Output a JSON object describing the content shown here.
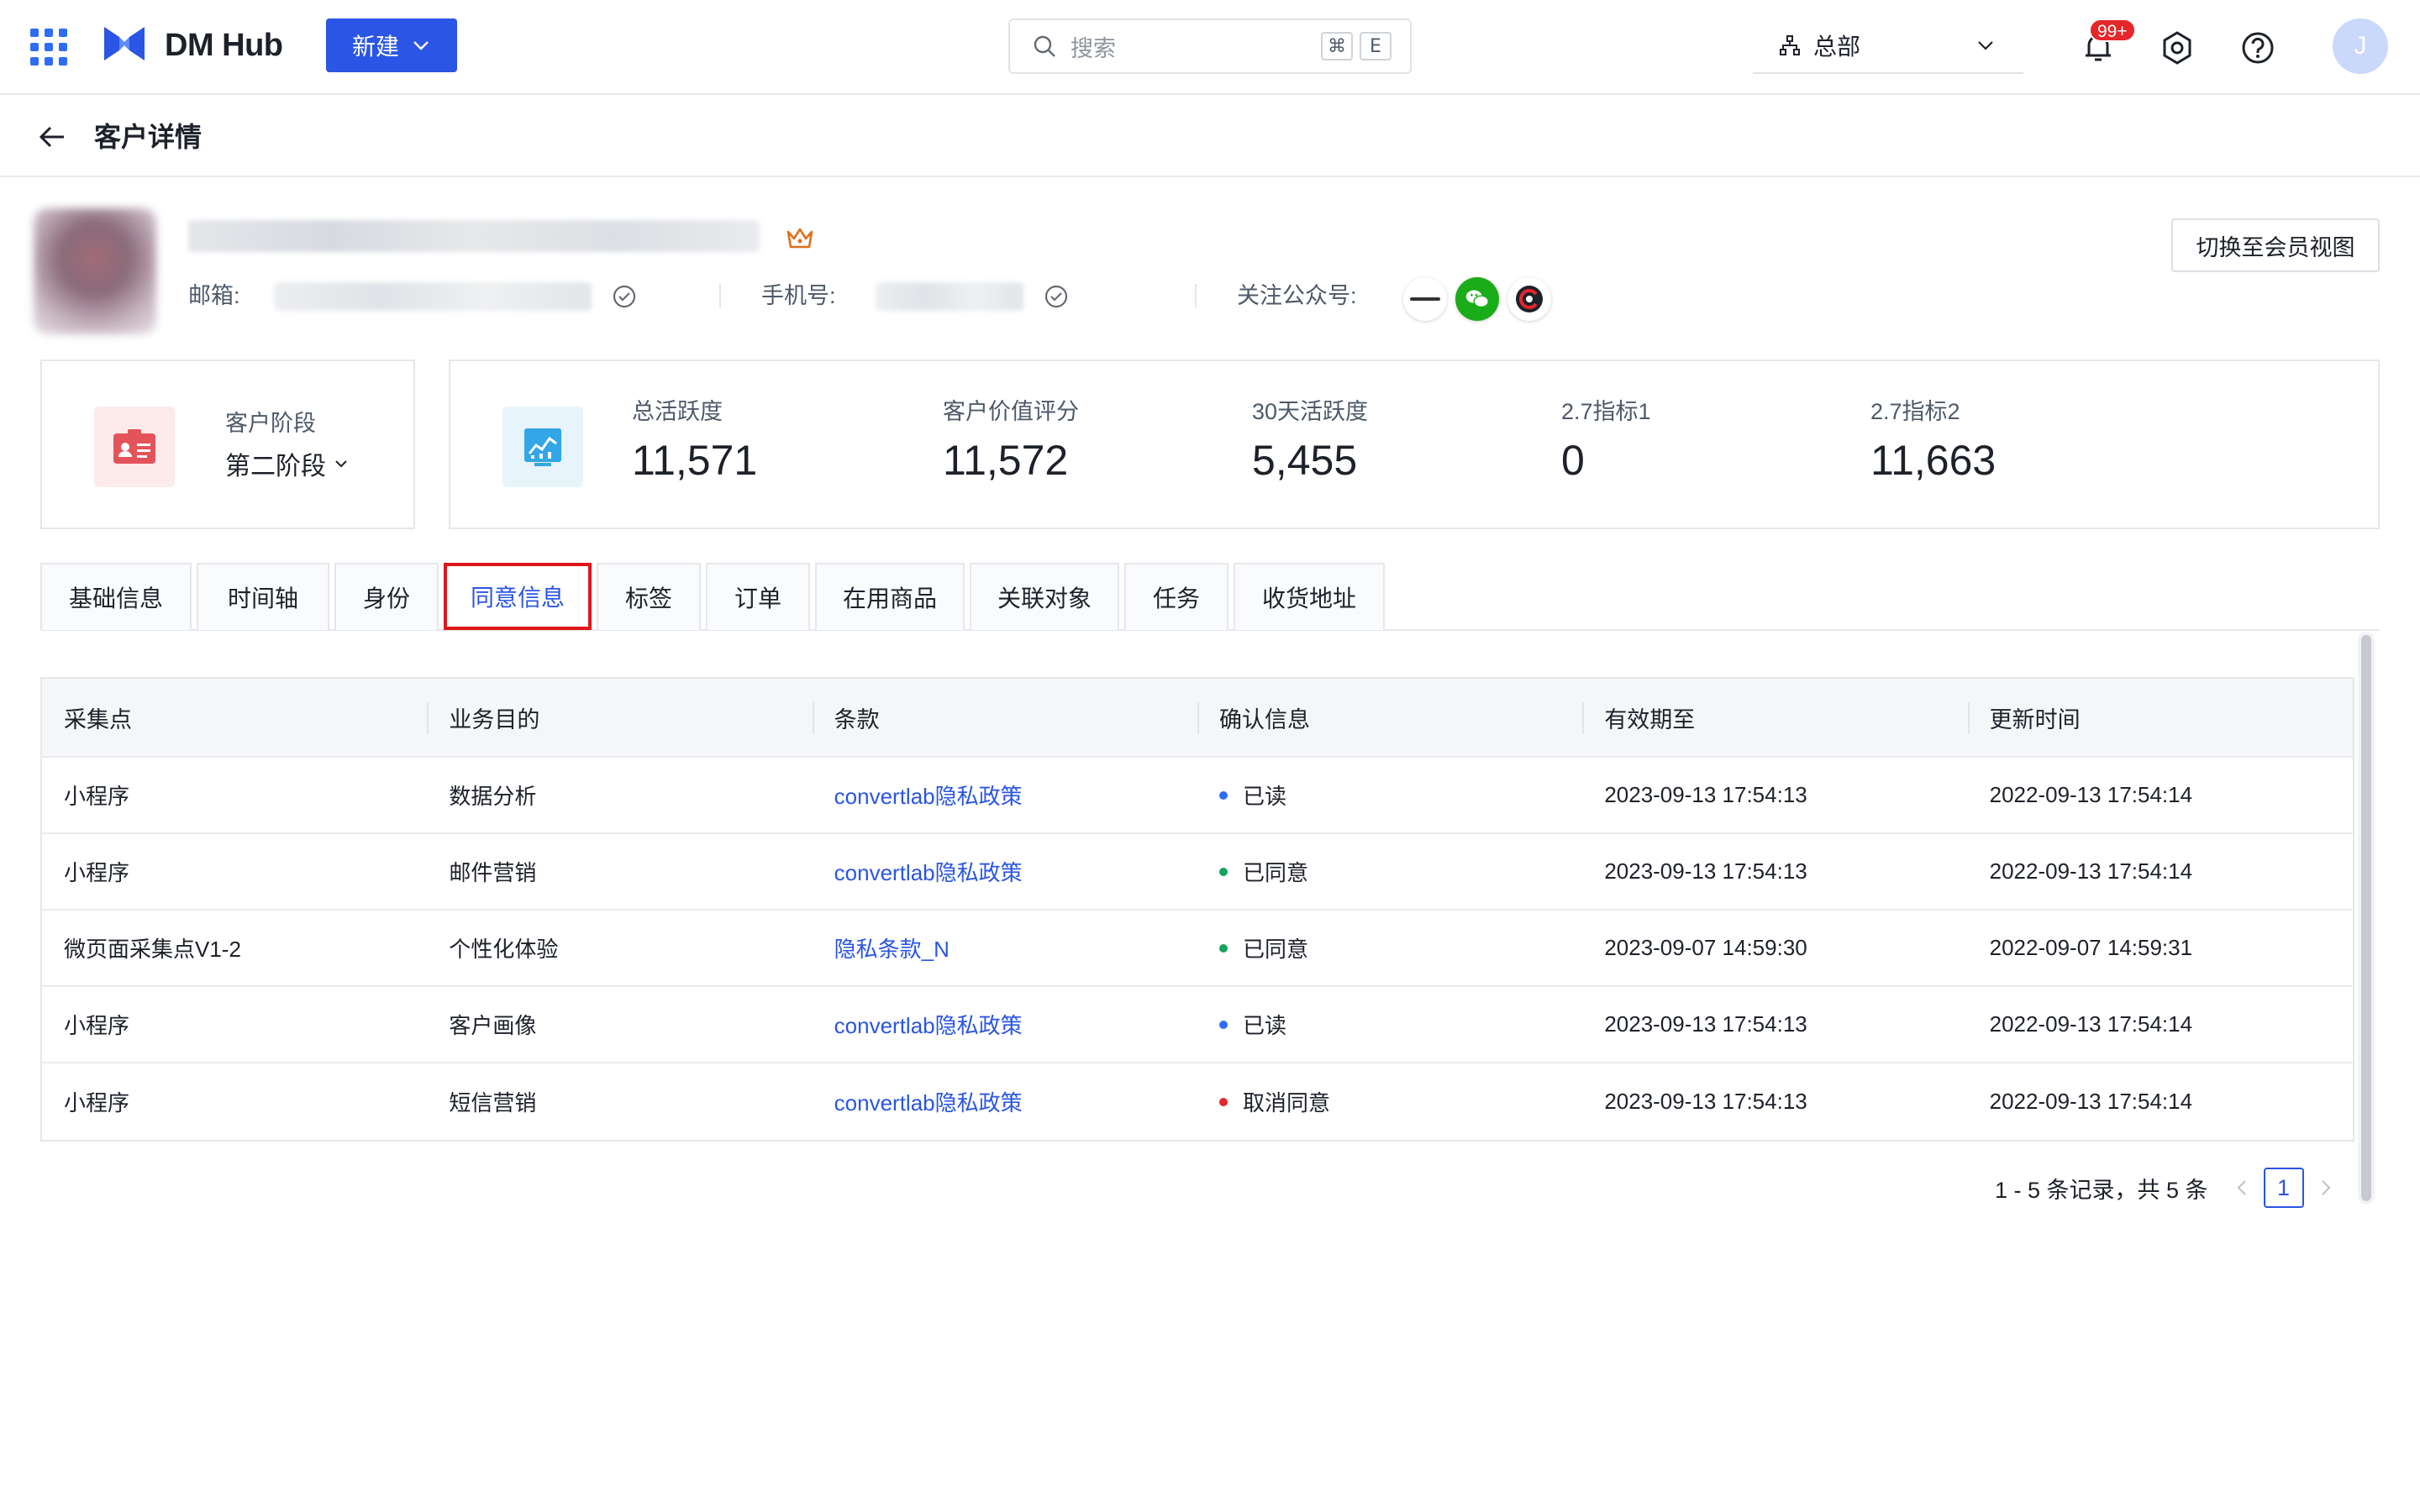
{
  "app": {
    "name": "DM Hub",
    "new_button": "新建",
    "search_placeholder": "搜索",
    "shortcut_cmd": "⌘",
    "shortcut_key": "E",
    "org": "总部",
    "notification_badge": "99+",
    "user_initial": "J",
    "accent_color": "#2a55e5"
  },
  "page": {
    "title": "客户详情",
    "switch_view": "切换至会员视图"
  },
  "profile": {
    "email_label": "邮箱:",
    "phone_label": "手机号:",
    "wechat_label": "关注公众号:"
  },
  "stage": {
    "label": "客户阶段",
    "value": "第二阶段"
  },
  "metrics": [
    {
      "label": "总活跃度",
      "value": "11,571"
    },
    {
      "label": "客户价值评分",
      "value": "11,572"
    },
    {
      "label": "30天活跃度",
      "value": "5,455"
    },
    {
      "label": "2.7指标1",
      "value": "0"
    },
    {
      "label": "2.7指标2",
      "value": "11,663"
    }
  ],
  "tabs": [
    "基础信息",
    "时间轴",
    "身份",
    "同意信息",
    "标签",
    "订单",
    "在用商品",
    "关联对象",
    "任务",
    "收货地址"
  ],
  "active_tab": "同意信息",
  "table": {
    "headers": [
      "采集点",
      "业务目的",
      "条款",
      "确认信息",
      "有效期至",
      "更新时间"
    ],
    "rows": [
      {
        "point": "小程序",
        "purpose": "数据分析",
        "terms": "convertlab隐私政策",
        "status": "已读",
        "status_color": "#2f6cf6",
        "valid_until": "2023-09-13 17:54:13",
        "updated": "2022-09-13 17:54:14"
      },
      {
        "point": "小程序",
        "purpose": "邮件营销",
        "terms": "convertlab隐私政策",
        "status": "已同意",
        "status_color": "#13a35b",
        "valid_until": "2023-09-13 17:54:13",
        "updated": "2022-09-13 17:54:14"
      },
      {
        "point": "微页面采集点V1-2",
        "purpose": "个性化体验",
        "terms": "隐私条款_N",
        "status": "已同意",
        "status_color": "#13a35b",
        "valid_until": "2023-09-07 14:59:30",
        "updated": "2022-09-07 14:59:31"
      },
      {
        "point": "小程序",
        "purpose": "客户画像",
        "terms": "convertlab隐私政策",
        "status": "已读",
        "status_color": "#2f6cf6",
        "valid_until": "2023-09-13 17:54:13",
        "updated": "2022-09-13 17:54:14"
      },
      {
        "point": "小程序",
        "purpose": "短信营销",
        "terms": "convertlab隐私政策",
        "status": "取消同意",
        "status_color": "#e5262b",
        "valid_until": "2023-09-13 17:54:13",
        "updated": "2022-09-13 17:54:14"
      }
    ]
  },
  "pagination": {
    "summary": "1 - 5 条记录，共 5 条",
    "current_page": "1"
  },
  "icons": {
    "apps": "apps-grid-icon",
    "search": "search-icon",
    "org": "org-tree-icon",
    "bell": "bell-icon",
    "settings": "settings-icon",
    "help": "help-icon",
    "back": "arrow-left-icon",
    "crown": "crown-icon",
    "verified": "check-circle-icon"
  }
}
